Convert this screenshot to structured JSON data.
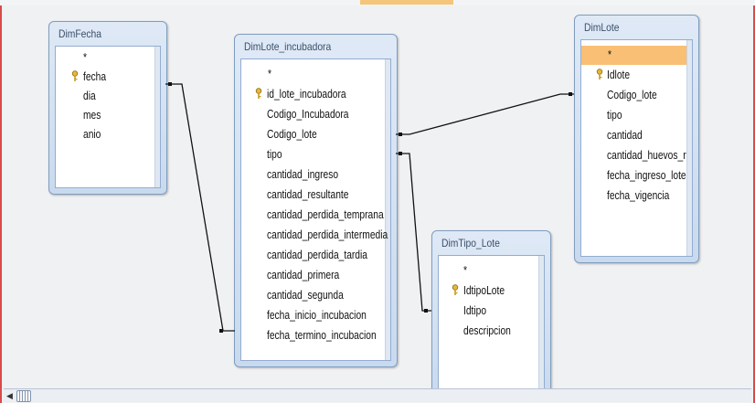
{
  "tables": [
    {
      "title": "DimFecha",
      "fields": [
        "*",
        "fecha",
        "dia",
        "mes",
        "anio"
      ],
      "key_fields": [
        "fecha"
      ],
      "selected_field": ""
    },
    {
      "title": "DimLote_incubadora",
      "fields": [
        "*",
        "id_lote_incubadora",
        "Codigo_Incubadora",
        "Codigo_lote",
        "tipo",
        "cantidad_ingreso",
        "cantidad_resultante",
        "cantidad_perdida_temprana",
        "cantidad_perdida_intermedia",
        "cantidad_perdida_tardia",
        "cantidad_primera",
        "cantidad_segunda",
        "fecha_inicio_incubacion",
        "fecha_termino_incubacion"
      ],
      "key_fields": [
        "id_lote_incubadora"
      ],
      "selected_field": ""
    },
    {
      "title": "DimTipo_Lote",
      "fields": [
        "*",
        "IdtipoLote",
        "Idtipo",
        "descripcion"
      ],
      "key_fields": [
        "IdtipoLote"
      ],
      "selected_field": ""
    },
    {
      "title": "DimLote",
      "fields": [
        "*",
        "Idlote",
        "Codigo_lote",
        "tipo",
        "cantidad",
        "cantidad_huevos_rot",
        "fecha_ingreso_lote",
        "fecha_vigencia"
      ],
      "key_fields": [
        "Idlote"
      ],
      "selected_field": "*"
    }
  ],
  "relationships": [
    {
      "from": "DimFecha.fecha",
      "to": "DimLote_incubadora.fecha_termino_incubacion"
    },
    {
      "from": "DimLote_incubadora.Codigo_lote",
      "to": "DimLote.Idlote"
    },
    {
      "from": "DimLote_incubadora.tipo",
      "to": "DimTipo_Lote.IdtipoLote"
    }
  ],
  "colors": {
    "selected_row": "#f9bf75",
    "border_accent": "#d94a4a",
    "table_header": "#d3e1f2"
  },
  "icons": {
    "primary_key": "key-icon",
    "scroll_left": "scroll-left-arrow-icon"
  }
}
